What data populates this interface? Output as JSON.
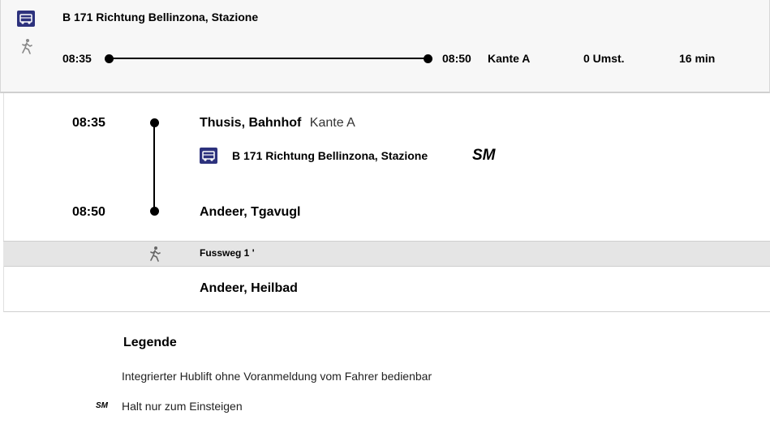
{
  "summary": {
    "line": "B 171 Richtung Bellinzona, Stazione",
    "dep_time": "08:35",
    "arr_time": "08:50",
    "platform": "Kante A",
    "transfers": "0 Umst.",
    "duration": "16 min"
  },
  "stops": [
    {
      "time": "08:35",
      "name": "Thusis, Bahnhof",
      "platform": "Kante A"
    },
    {
      "time": "08:50",
      "name": "Andeer, Tgavugl",
      "platform": ""
    }
  ],
  "leg": {
    "line": "B 171 Richtung Bellinzona, Stazione",
    "attribute": "SM"
  },
  "walk": {
    "label": "Fussweg 1 '"
  },
  "final_stop": {
    "name": "Andeer, Heilbad"
  },
  "legend": {
    "title": "Legende",
    "items": [
      {
        "code": "",
        "text": "Integrierter Hublift ohne Voranmeldung vom Fahrer bedienbar"
      },
      {
        "code": "SM",
        "text": "Halt nur zum Einsteigen"
      }
    ]
  },
  "colors": {
    "bus_icon": "#2d327d",
    "walk_band": "#e5e5e5",
    "summary_bg": "#f7f7f7"
  },
  "icons": {
    "bus": "bus-icon",
    "walk": "walk-icon"
  }
}
